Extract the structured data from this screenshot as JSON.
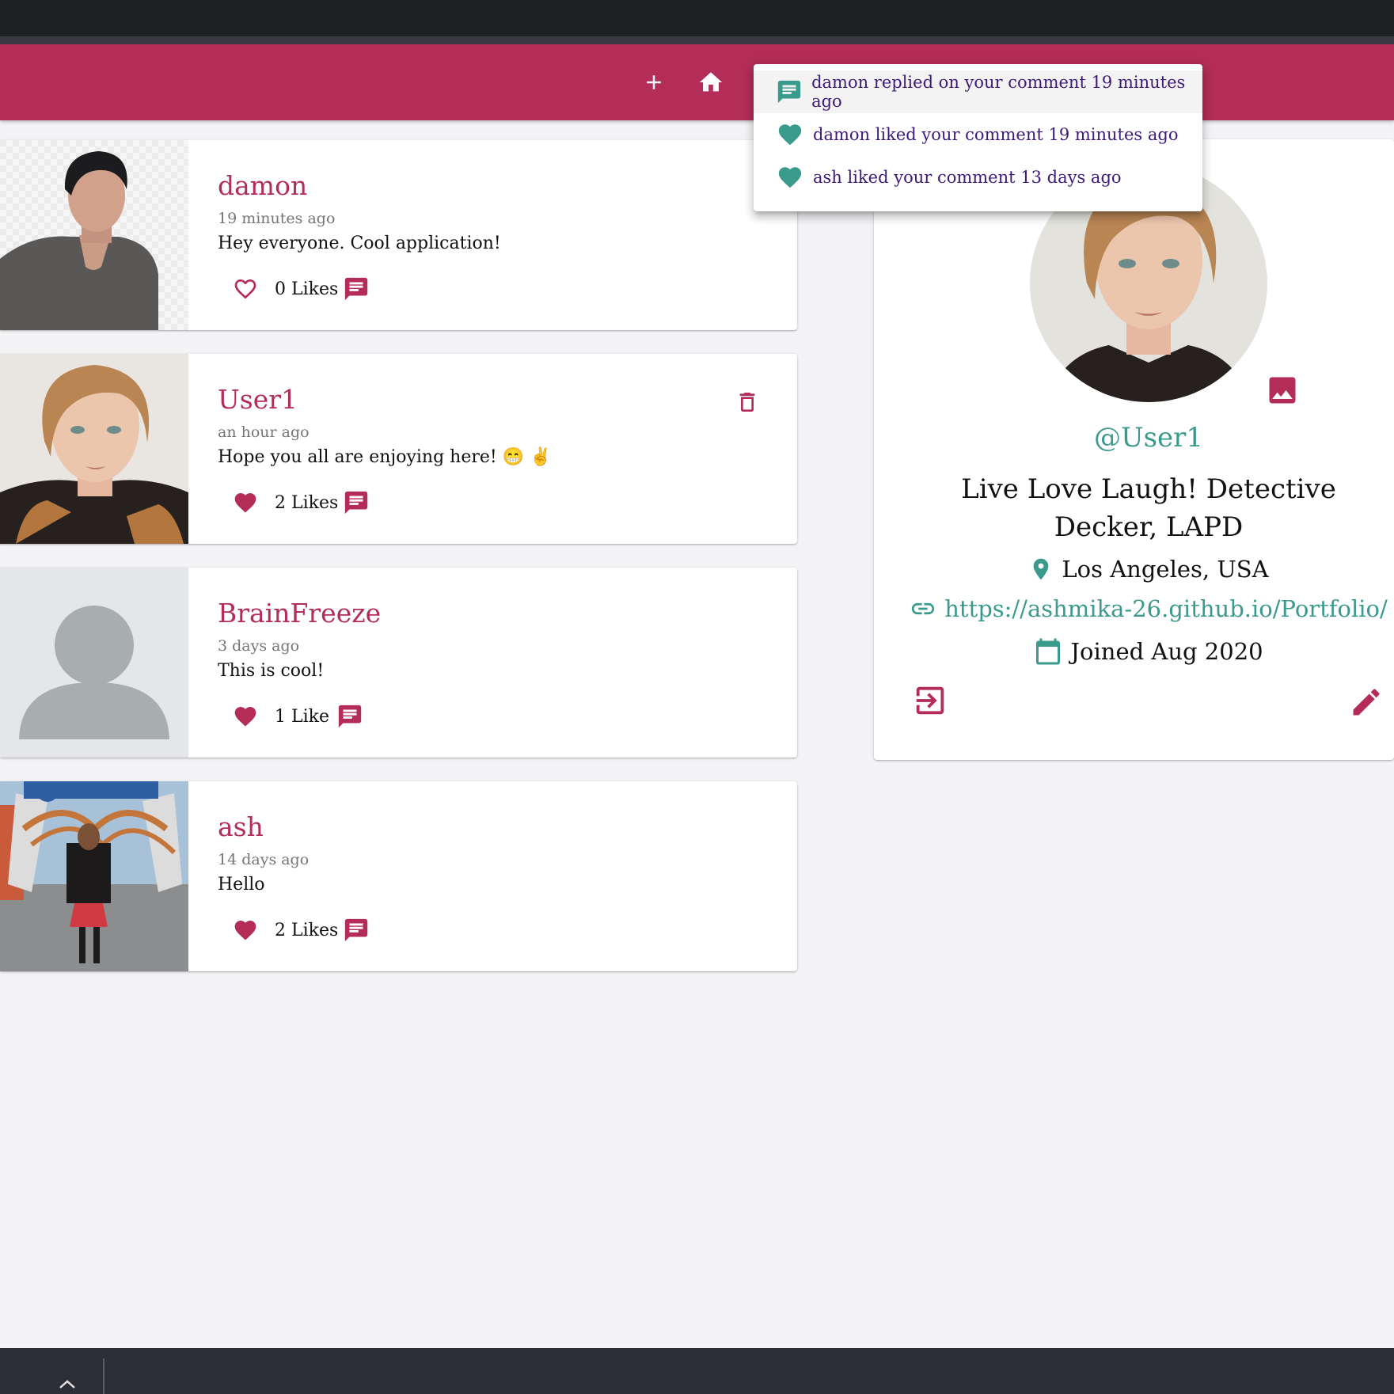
{
  "appbar": {
    "add_icon": "add-icon",
    "home_icon": "home-icon"
  },
  "posts": [
    {
      "user": "damon",
      "time": "19 minutes ago",
      "body": "Hey everyone. Cool application!",
      "likes": "0 Likes",
      "liked": false,
      "deletable": false
    },
    {
      "user": "User1",
      "time": "an hour ago",
      "body": "Hope you all are enjoying here! 😁 ✌️",
      "likes": "2 Likes",
      "liked": true,
      "deletable": true
    },
    {
      "user": "BrainFreeze",
      "time": "3 days ago",
      "body": "This is cool!",
      "likes": "1 Like",
      "liked": true,
      "deletable": false
    },
    {
      "user": "ash",
      "time": "14 days ago",
      "body": "Hello",
      "likes": "2 Likes",
      "liked": true,
      "deletable": false
    }
  ],
  "profile": {
    "handle": "@User1",
    "bio": "Live Love Laugh! Detective Decker, LAPD",
    "location": "Los Angeles, USA",
    "website": "https://ashmika-26.github.io/Portfolio/",
    "joined": "Joined Aug 2020"
  },
  "notifications": [
    {
      "icon": "chat-icon",
      "text": "damon replied on your comment 19 minutes ago"
    },
    {
      "icon": "heart-icon",
      "text": "damon liked your comment 19 minutes ago"
    },
    {
      "icon": "heart-icon",
      "text": "ash liked your comment 13 days ago"
    }
  ],
  "colors": {
    "primary": "#b32d58",
    "secondary": "#3a9a8c",
    "notification_text": "#3d1a78"
  }
}
